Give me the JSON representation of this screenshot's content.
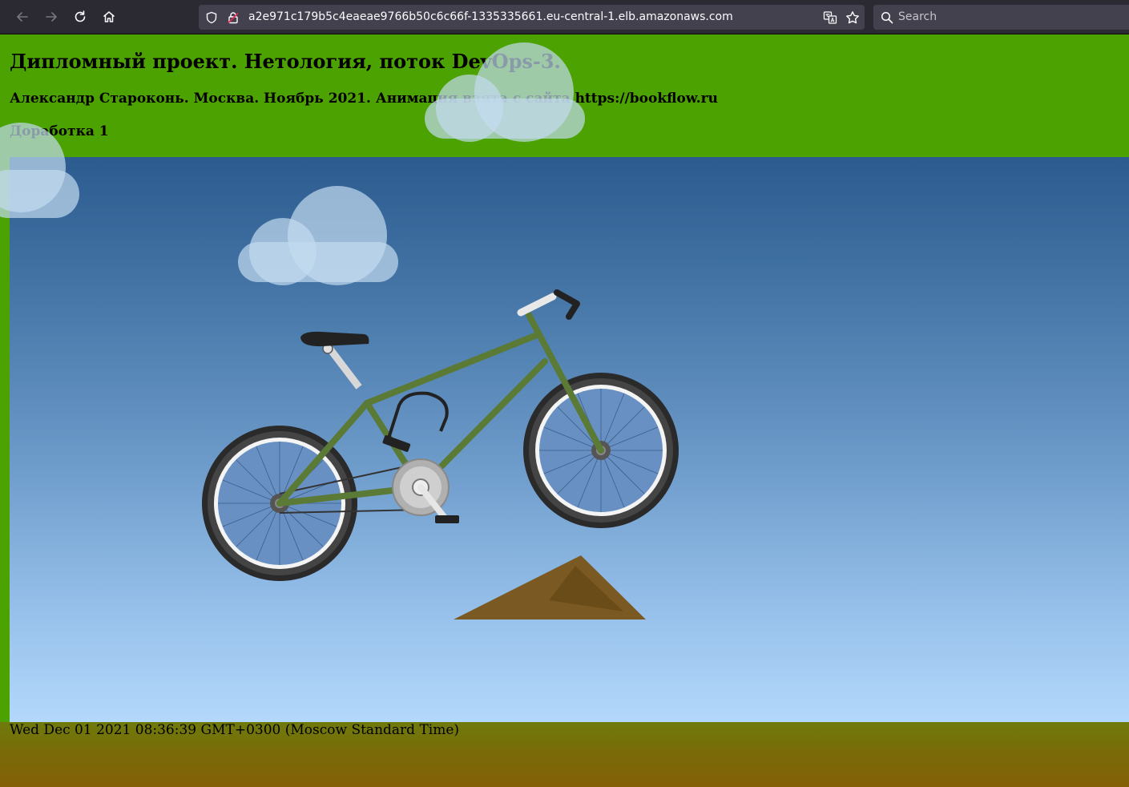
{
  "browser": {
    "url": "a2e971c179b5c4eaeae9766b50c6c66f-1335335661.eu-central-1.elb.amazonaws.com",
    "search_placeholder": "Search",
    "icons": [
      "back-arrow-icon",
      "forward-arrow-icon",
      "reload-icon",
      "home-icon",
      "shield-icon",
      "insecure-lock-icon",
      "translate-icon",
      "bookmark-star-icon",
      "search-icon"
    ]
  },
  "page": {
    "title": "Дипломный проект. Нетология, поток DevOps-3.",
    "subtitle": "Александр Староконь. Москва. Ноябрь 2021. Анимация взята с сайта https://bookflow.ru",
    "revision": "Доработка 1",
    "timestamp": "Wed Dec 01 2021 08:36:39 GMT+0300 (Moscow Standard Time)"
  },
  "colors": {
    "header_green": "#4ca200",
    "sky_top": "#2c5b8f",
    "sky_bottom": "#b3d8fb",
    "ground": "#7a6a08",
    "bike_frame": "#5a7a35",
    "ramp": "#7a5a22"
  }
}
